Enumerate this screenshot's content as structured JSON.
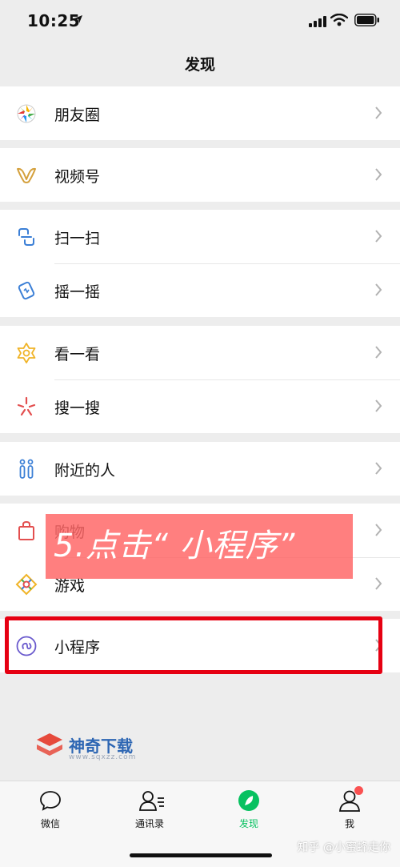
{
  "status": {
    "time": "10:25"
  },
  "nav": {
    "title": "发现"
  },
  "groups": [
    {
      "items": [
        {
          "label": "朋友圈",
          "icon": "moments-icon"
        }
      ]
    },
    {
      "items": [
        {
          "label": "视频号",
          "icon": "channels-icon"
        }
      ]
    },
    {
      "items": [
        {
          "label": "扫一扫",
          "icon": "scan-icon"
        },
        {
          "label": "摇一摇",
          "icon": "shake-icon"
        }
      ]
    },
    {
      "items": [
        {
          "label": "看一看",
          "icon": "top-stories-icon"
        },
        {
          "label": "搜一搜",
          "icon": "search-icon"
        }
      ]
    },
    {
      "items": [
        {
          "label": "附近的人",
          "icon": "people-nearby-icon"
        }
      ]
    },
    {
      "items": [
        {
          "label": "购物",
          "icon": "shopping-bag-icon"
        },
        {
          "label": "游戏",
          "icon": "games-icon"
        }
      ]
    },
    {
      "items": [
        {
          "label": "小程序",
          "icon": "mini-programs-icon"
        }
      ]
    }
  ],
  "overlay": {
    "instruction": "5.点击“ 小程序”"
  },
  "watermark": {
    "brand": "神奇下载",
    "url": "www.sqxzz.com"
  },
  "tabs": [
    {
      "label": "微信",
      "icon": "chat-icon",
      "active": false
    },
    {
      "label": "通讯录",
      "icon": "contacts-icon",
      "active": false
    },
    {
      "label": "发现",
      "icon": "discover-compass-icon",
      "active": true
    },
    {
      "label": "我",
      "icon": "me-icon",
      "active": false,
      "badge": true
    }
  ],
  "footer_watermark": "知乎 @小蜜蜂走你",
  "colors": {
    "accent": "#07c160",
    "highlight": "#e60012",
    "overlay": "#ff6666",
    "badge": "#fa5151"
  }
}
